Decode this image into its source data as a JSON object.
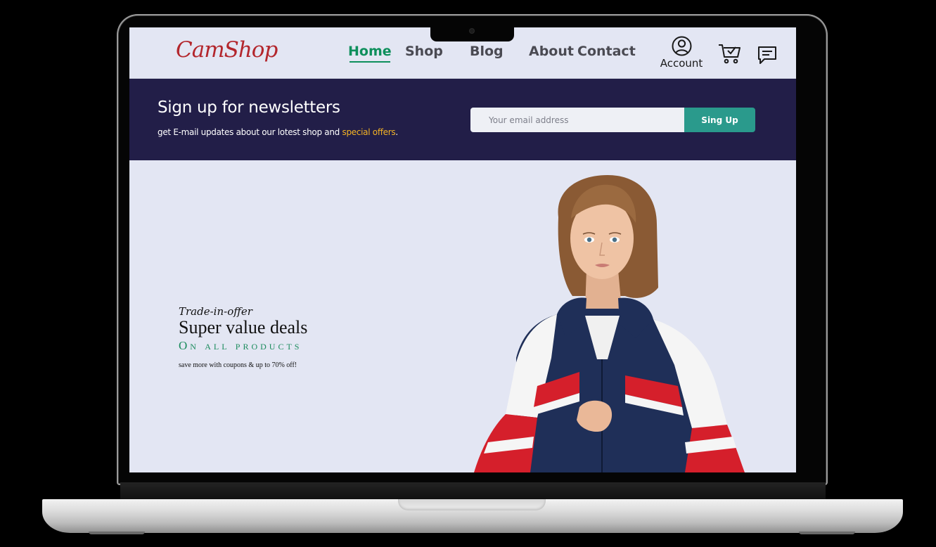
{
  "brand": {
    "logo_text": "CamShop",
    "logo_color": "#b3262c"
  },
  "nav": {
    "items": [
      {
        "label": "Home",
        "active": true
      },
      {
        "label": "Shop",
        "active": false
      },
      {
        "label": "Blog",
        "active": false
      },
      {
        "label": "About",
        "active": false
      },
      {
        "label": "Contact",
        "active": false
      }
    ],
    "active_color": "#0e8f5c"
  },
  "header_actions": {
    "account_label": "Account",
    "account_icon": "user-circle-icon",
    "cart_icon": "cart-check-icon",
    "chat_icon": "chat-bubble-icon"
  },
  "newsletter": {
    "title": "Sign up for newsletters",
    "subtitle_prefix": "get E-mail updates about our lotest shop and ",
    "subtitle_highlight": "special offers",
    "subtitle_suffix": ".",
    "email_placeholder": "Your email address",
    "email_value": "",
    "button_label": "Sing Up",
    "background": "#221e48",
    "button_color": "#2a9a8c",
    "highlight_color": "#f4b324"
  },
  "hero": {
    "kicker": "Trade-in-offer",
    "title": "Super value deals",
    "subtitle": "On all products",
    "note": "save more with coupons & up to 70% off!",
    "accent_color": "#1a8b5c",
    "image": "model-in-windbreaker-jacket"
  },
  "device": {
    "frame": "laptop"
  }
}
